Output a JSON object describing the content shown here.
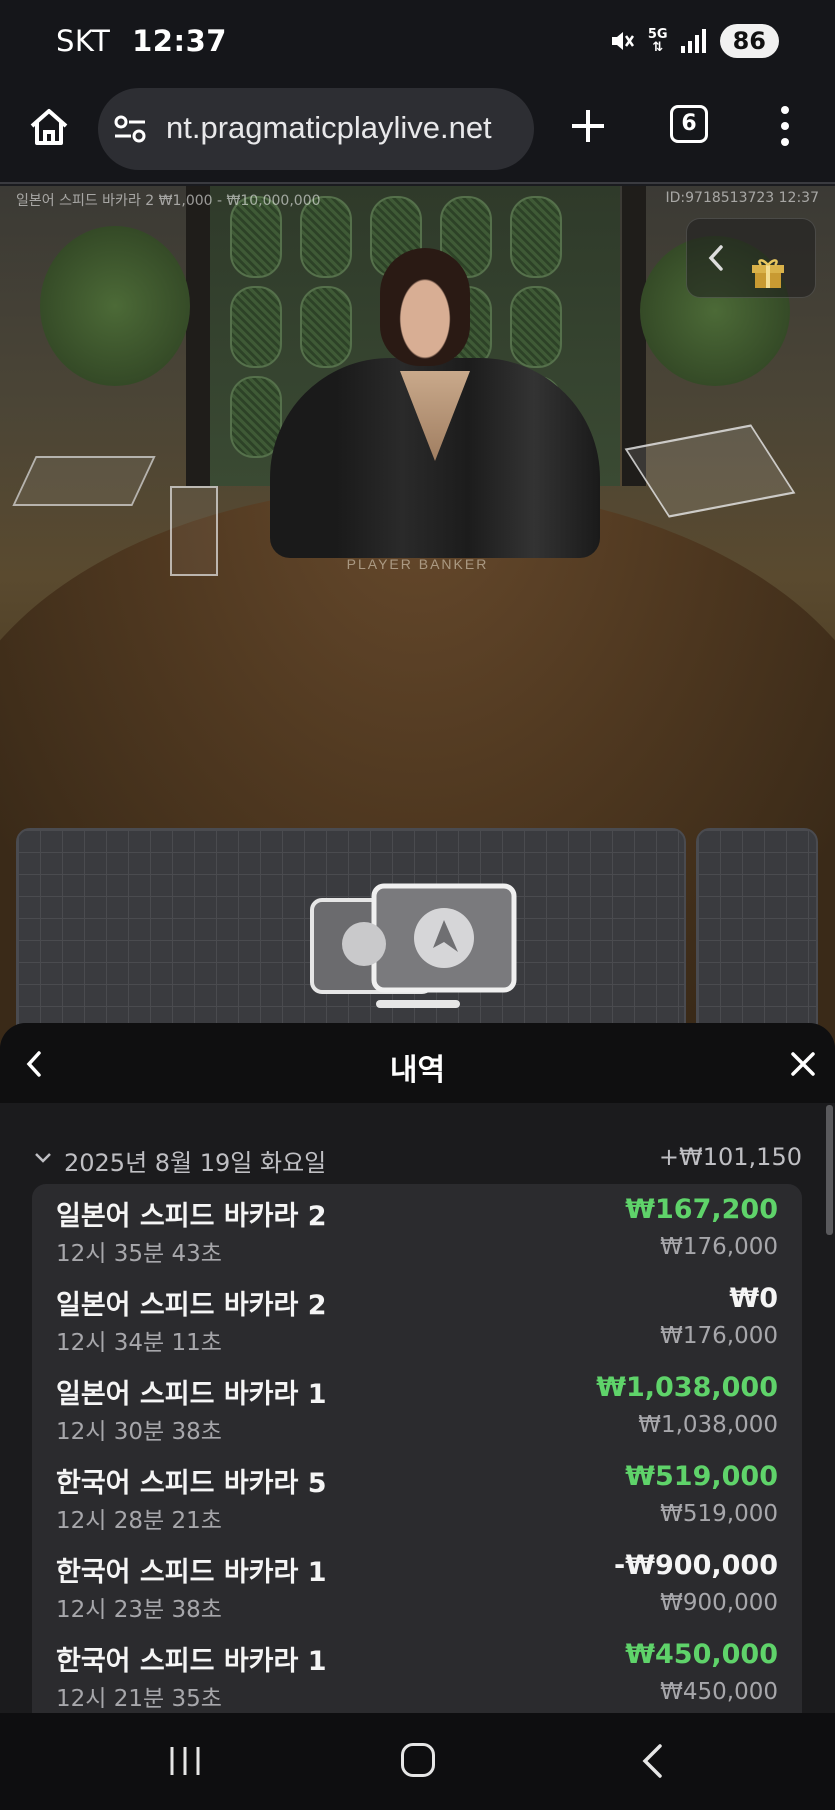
{
  "status_bar": {
    "carrier": "SKT",
    "time": "12:37",
    "network": "5G",
    "battery": "86"
  },
  "browser": {
    "url": "nt.pragmaticplaylive.net",
    "tab_count": "6",
    "icons": [
      "home-icon",
      "site-settings-icon",
      "plus-icon",
      "tabs-icon",
      "more-vert-icon"
    ]
  },
  "stream": {
    "table_info": "일본어 스피드 바카라 2  ₩1,000 - ₩10,000,000",
    "id_info": "ID:9718513723  12:37",
    "table_text": "PLAYER  BANKER"
  },
  "history": {
    "title": "내역",
    "date_group": {
      "label": "2025년 8월 19일 화요일",
      "total": "+₩101,150"
    },
    "colors": {
      "win": "#5fd36a",
      "neutral": "#f5f5f5"
    },
    "rows": [
      {
        "game": "일본어 스피드 바카라 2",
        "time": "12시 35분 43초",
        "result": "₩167,200",
        "bet": "₩176,000",
        "status": "win"
      },
      {
        "game": "일본어 스피드 바카라 2",
        "time": "12시 34분 11초",
        "result": "₩0",
        "bet": "₩176,000",
        "status": "neutral"
      },
      {
        "game": "일본어 스피드 바카라 1",
        "time": "12시 30분 38초",
        "result": "₩1,038,000",
        "bet": "₩1,038,000",
        "status": "win"
      },
      {
        "game": "한국어 스피드 바카라 5",
        "time": "12시 28분 21초",
        "result": "₩519,000",
        "bet": "₩519,000",
        "status": "win"
      },
      {
        "game": "한국어 스피드 바카라 1",
        "time": "12시 23분 38초",
        "result": "-₩900,000",
        "bet": "₩900,000",
        "status": "neutral"
      },
      {
        "game": "한국어 스피드 바카라 1",
        "time": "12시 21분 35초",
        "result": "₩450,000",
        "bet": "₩450,000",
        "status": "win"
      }
    ]
  }
}
